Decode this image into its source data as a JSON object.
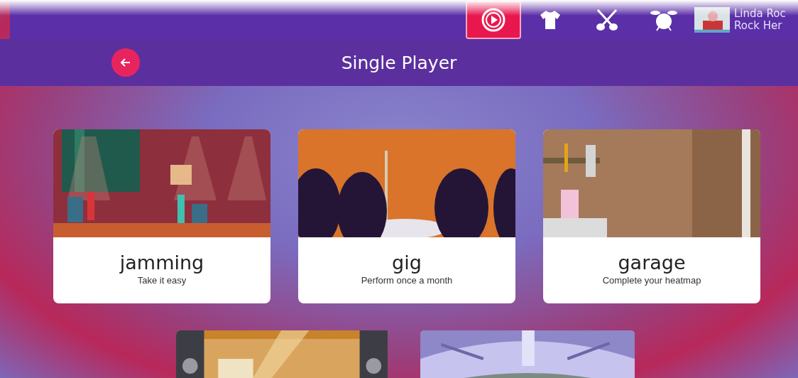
{
  "top_bar": {
    "tabs": [
      {
        "kind": "play",
        "selected": true
      },
      {
        "kind": "shirt",
        "selected": false
      },
      {
        "kind": "guitars",
        "selected": false
      },
      {
        "kind": "drum",
        "selected": false
      }
    ],
    "profile": {
      "name": "Linda Roc",
      "rank": "Rock Her"
    }
  },
  "header": {
    "title": "Single Player"
  },
  "modes": [
    {
      "title": "jamming",
      "subtitle": "Take it easy"
    },
    {
      "title": "gig",
      "subtitle": "Perform once a month"
    },
    {
      "title": "garage",
      "subtitle": "Complete your heatmap"
    }
  ]
}
